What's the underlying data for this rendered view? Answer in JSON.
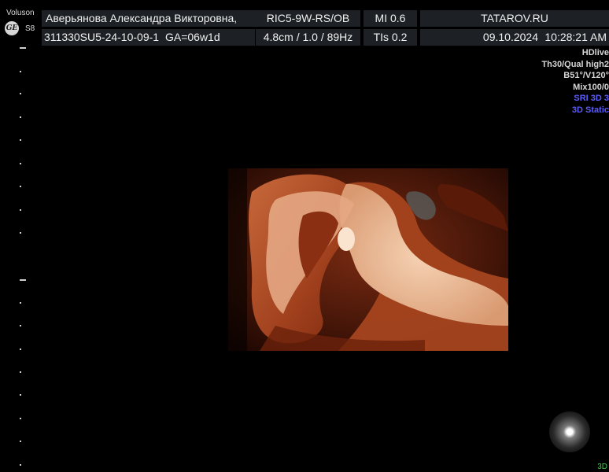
{
  "header": {
    "brand": "Voluson",
    "model": "S8",
    "logo_text": "GE",
    "patient_name": "Аверьянова Александра Викторовна,",
    "patient_id": "311330SU5-24-10-09-1",
    "gestational_age": "GA=06w1d",
    "probe": "RIC5-9W-RS/OB",
    "depth_freq": "4.8cm / 1.0 / 89Hz",
    "mi": "MI  0.6",
    "tis": "TIs  0.2",
    "institution": "TATAROV.RU",
    "date": "09.10.2024",
    "time": "10:28:21 AM"
  },
  "settings": {
    "mode": "HDlive",
    "threshold_quality": "Th30/Qual high2",
    "angles": "B51°/V120°",
    "mix": "Mix100/0",
    "sri": "SRI 3D 3",
    "static": "3D Static"
  },
  "colors": {
    "header_cell": "#1d2024",
    "render_dark": "#4a1808",
    "render_mid": "#b5532c",
    "render_light": "#f1c7a3",
    "blue_text": "#5b5bff",
    "green_text": "#3fd14a"
  },
  "footer": {
    "mode_label": "3D"
  }
}
